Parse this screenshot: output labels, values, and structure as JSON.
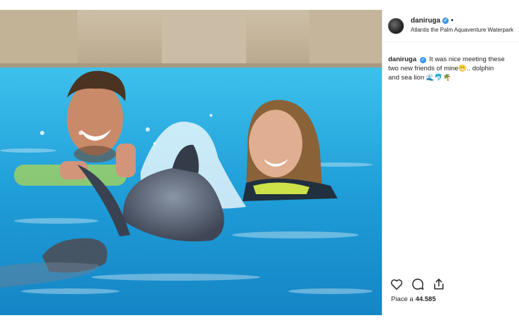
{
  "post": {
    "username": "daniruga",
    "separator": "•",
    "location": "Atlantis the Palm Aquaventure Waterpark",
    "caption": {
      "username": "daniruga",
      "text_line1": "It was nice meeting these",
      "text_line2": "two new friends of mine",
      "text_line3": "dolphin",
      "text_line4": "and sea lion"
    },
    "likes": {
      "label": "Piace a",
      "count": "44.585"
    }
  },
  "icons": {
    "verified": "verified-badge-icon",
    "like": "heart-icon",
    "comment": "comment-bubble-icon",
    "share": "share-icon"
  },
  "colors": {
    "pool": "#2aa7de",
    "verified": "#3897f0",
    "text": "#262626"
  }
}
